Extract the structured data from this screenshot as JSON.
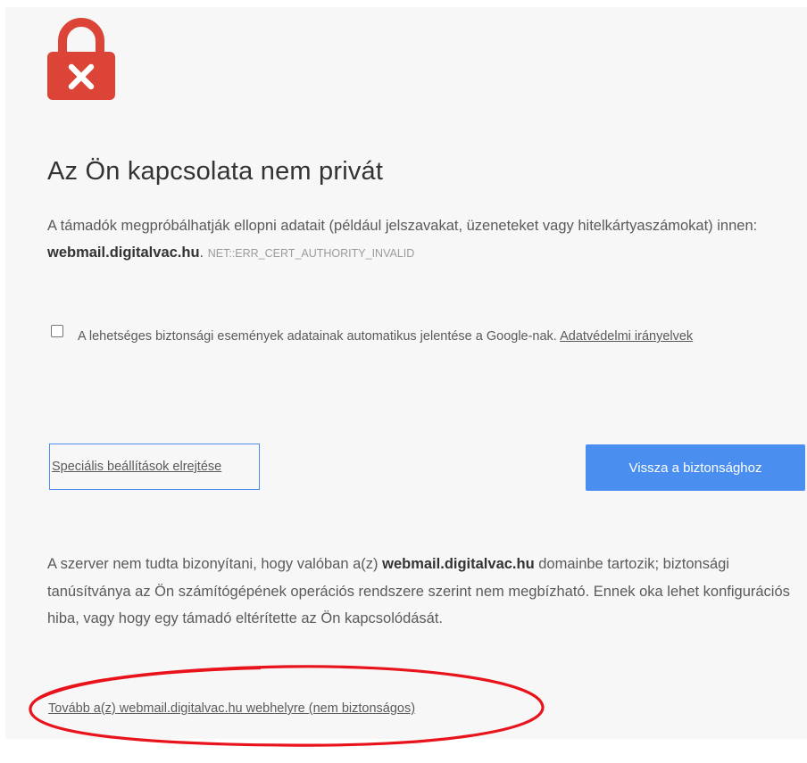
{
  "icons": {
    "lock": "lock-error-icon"
  },
  "colors": {
    "lock": "#db4437",
    "primary_button": "#4a8ff0",
    "annotation": "#e8131b"
  },
  "heading": {
    "title": "Az Ön kapcsolata nem privát"
  },
  "description": {
    "intro": "A támadók megpróbálhatják ellopni adatait (például jelszavakat, üzeneteket vagy hitelkártyaszámokat) innen: ",
    "domain": "webmail.digitalvac.hu",
    "after_domain": ".",
    "error_code": "NET::ERR_CERT_AUTHORITY_INVALID"
  },
  "report": {
    "checked": false,
    "text": "A lehetséges biztonsági események adatainak automatikus jelentése a Google-nak. ",
    "privacy_link": "Adatvédelmi irányelvek"
  },
  "buttons": {
    "advanced": "Speciális beállítások elrejtése",
    "back": "Vissza a biztonsághoz"
  },
  "details": {
    "before_domain": "A szerver nem tudta bizonyítani, hogy valóban a(z) ",
    "domain": "webmail.digitalvac.hu",
    "after_domain": " domainbe tartozik; biztonsági tanúsítványa az Ön számítógépének operációs rendszere szerint nem megbízható. Ennek oka lehet konfigurációs hiba, vagy hogy egy támadó eltérítette az Ön kapcsolódását.",
    "proceed_link": "Tovább a(z) webmail.digitalvac.hu webhelyre (nem biztonságos)"
  }
}
